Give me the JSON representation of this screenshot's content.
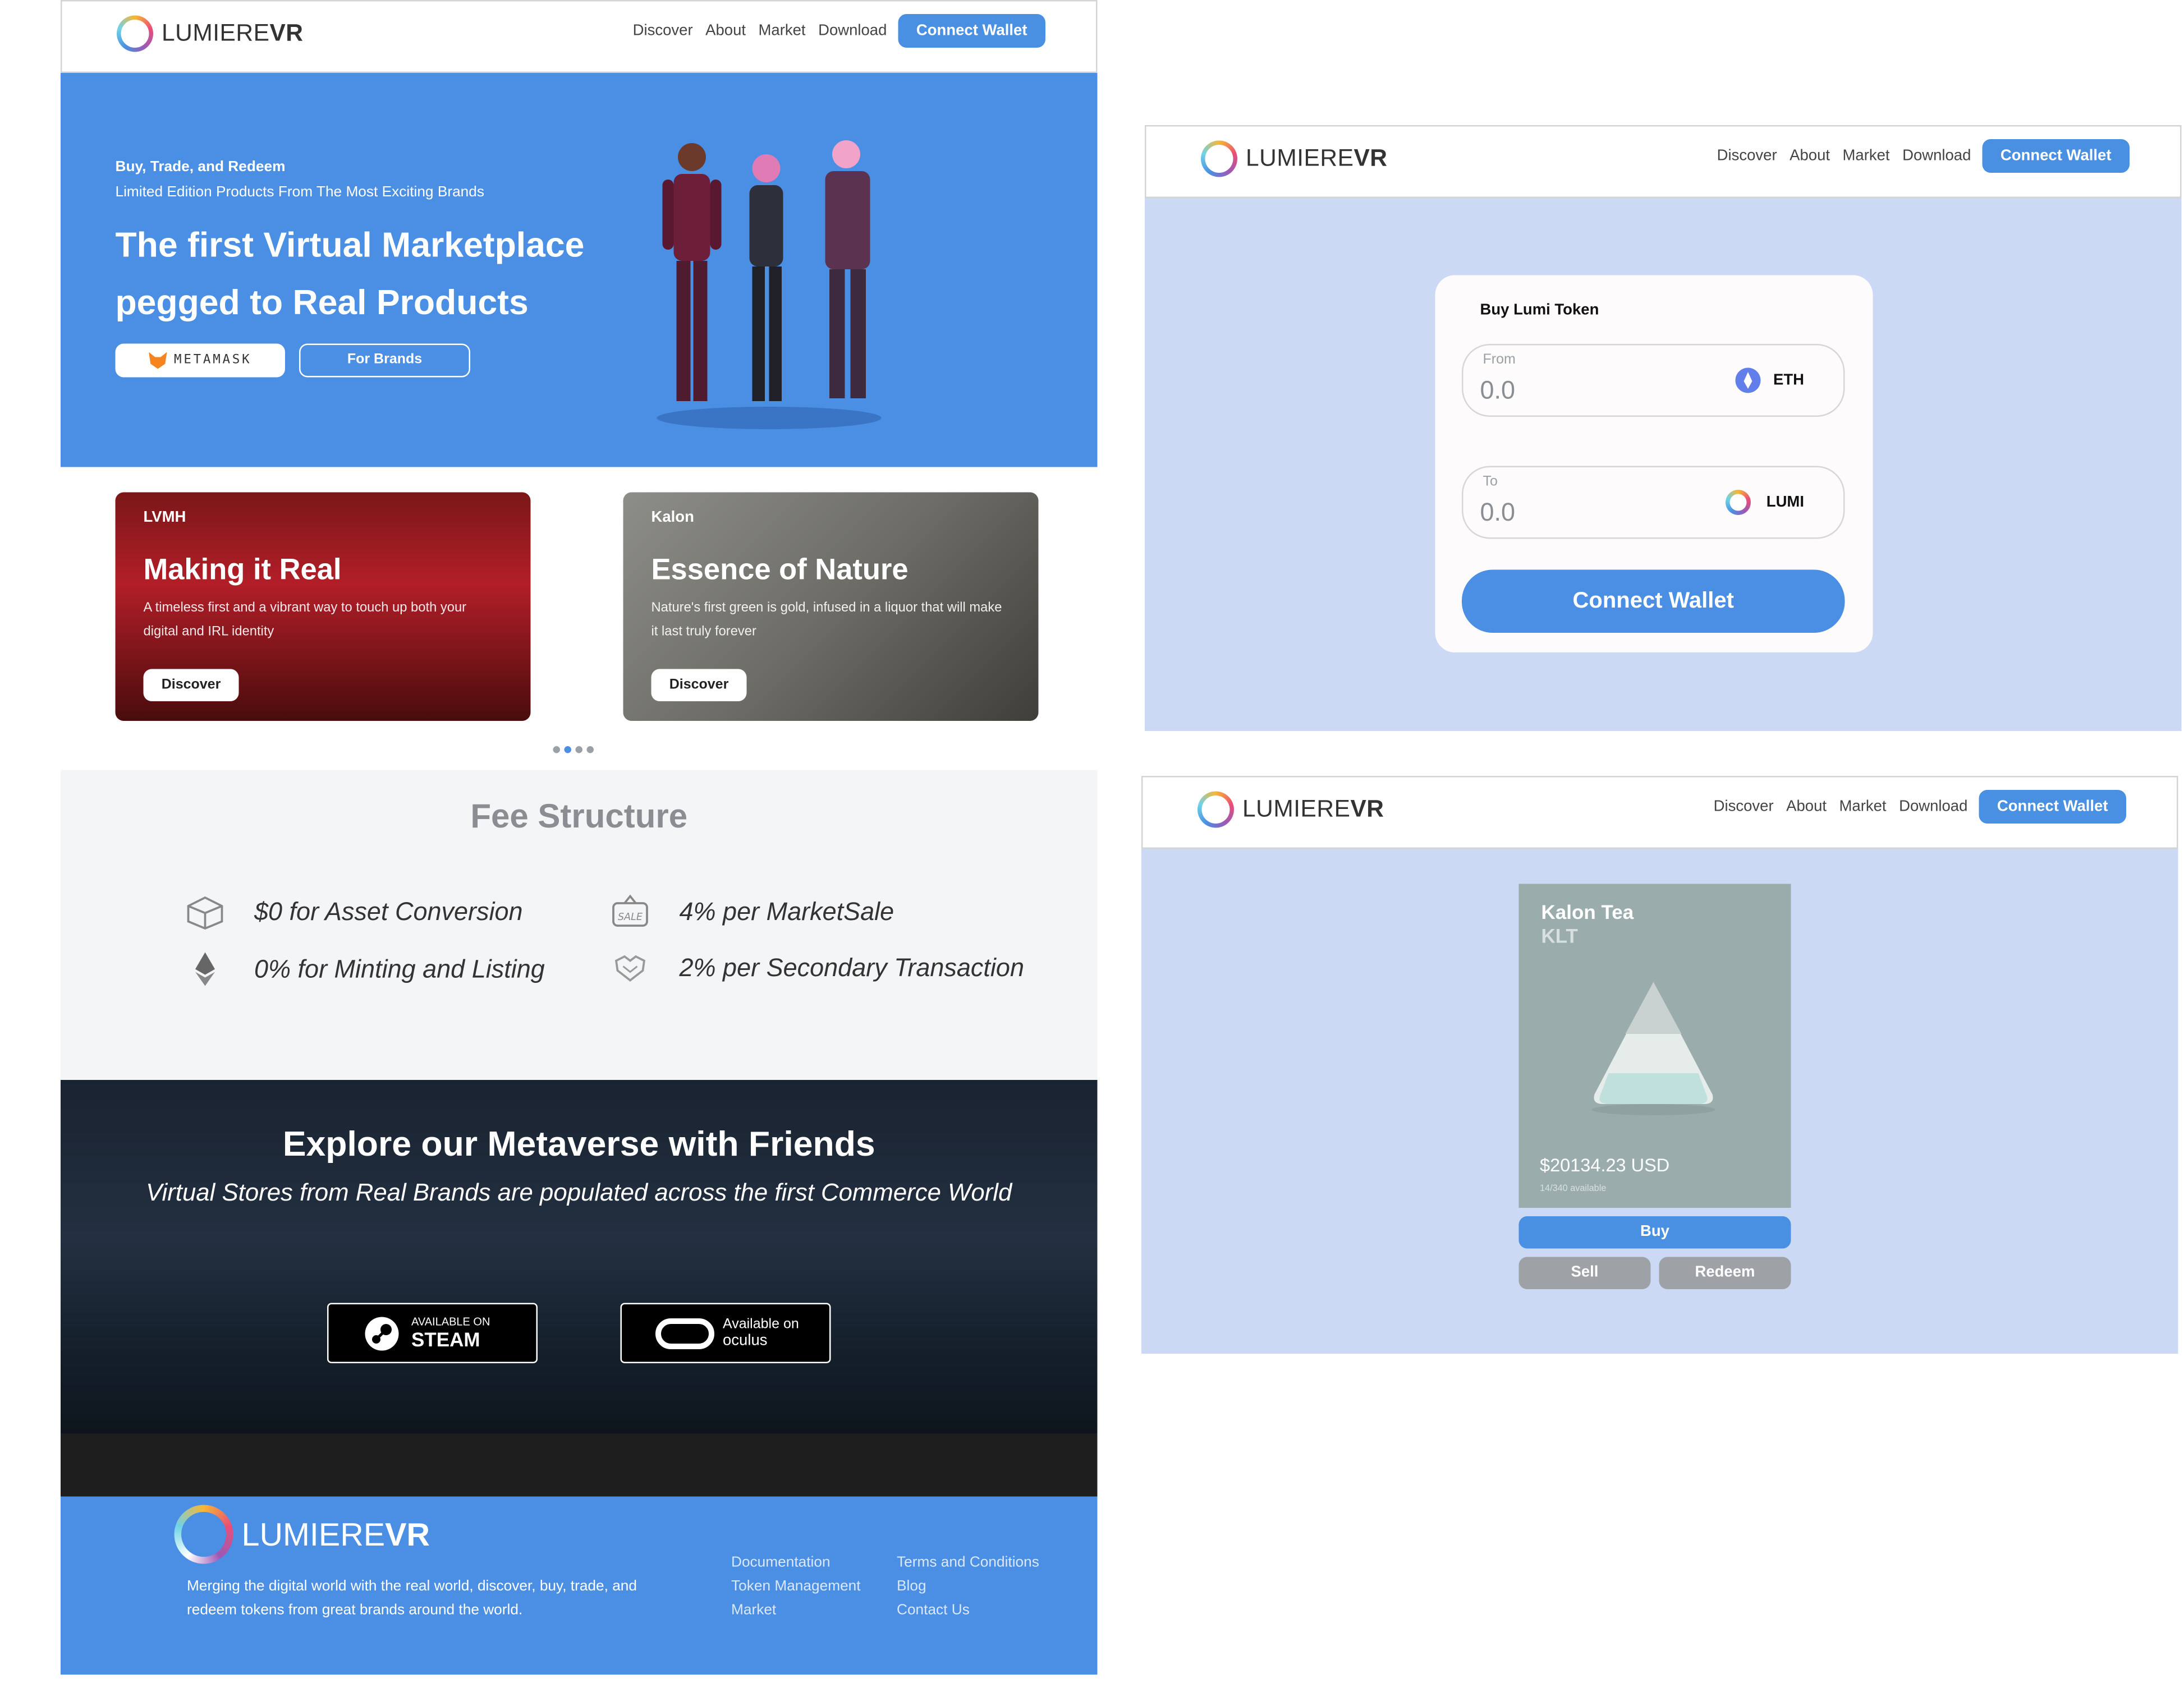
{
  "nav": {
    "logo_light": "LUMIERE",
    "logo_bold": "VR",
    "links": [
      "Discover",
      "About",
      "Market",
      "Download"
    ],
    "connect_label": "Connect Wallet"
  },
  "hero": {
    "kicker": "Buy, Trade, and Redeem",
    "subtitle": "Limited Edition Products From The Most Exciting Brands",
    "title": "The first Virtual Marketplace pegged to Real Products",
    "metamask_label": "METAMASK",
    "brands_label": "For Brands"
  },
  "cards": [
    {
      "brand": "LVMH",
      "title": "Making it Real",
      "description": "A timeless first and a vibrant way to touch up both your digital and IRL identity",
      "button": "Discover"
    },
    {
      "brand": "Kalon",
      "title": "Essence of Nature",
      "description": "Nature's first green is gold, infused in a liquor that will make it last truly forever",
      "button": "Discover"
    }
  ],
  "carousel": {
    "count": 4,
    "active_index": 1
  },
  "fees": {
    "title": "Fee Structure",
    "items": [
      {
        "text": "$0 for Asset Conversion",
        "icon": "box-icon"
      },
      {
        "text": "4% per MarketSale",
        "icon": "sale-tag-icon"
      },
      {
        "text": "0% for Minting and Listing",
        "icon": "ethereum-icon"
      },
      {
        "text": "2% per Secondary Transaction",
        "icon": "handshake-icon"
      }
    ]
  },
  "metaverse": {
    "title": "Explore our Metaverse with Friends",
    "subtitle": "Virtual Stores from Real Brands are populated across the first Commerce World",
    "steam_small": "AVAILABLE ON",
    "steam_big": "STEAM",
    "oculus_small": "Available on",
    "oculus_big": "oculus"
  },
  "footer": {
    "logo_light": "LUMIERE",
    "logo_bold": "VR",
    "description": "Merging the digital world with the real world, discover, buy, trade, and redeem tokens from great brands around the world.",
    "col1": [
      "Documentation",
      "Token Management",
      "Market"
    ],
    "col2": [
      "Terms and Conditions",
      "Blog",
      "Contact Us"
    ]
  },
  "swap": {
    "title": "Buy Lumi Token",
    "from_label": "From",
    "from_value": "0.0",
    "from_token": "ETH",
    "to_label": "To",
    "to_value": "0.0",
    "to_token": "LUMI",
    "button": "Connect Wallet"
  },
  "product": {
    "name": "Kalon Tea",
    "symbol": "KLT",
    "price": "$20134.23 USD",
    "availability": "14/340 available",
    "buy": "Buy",
    "sell": "Sell",
    "redeem": "Redeem"
  },
  "colors": {
    "brand_blue": "#4a8fe3",
    "panel_bg": "#cbd9f4",
    "fee_bg": "#f4f5f7"
  }
}
